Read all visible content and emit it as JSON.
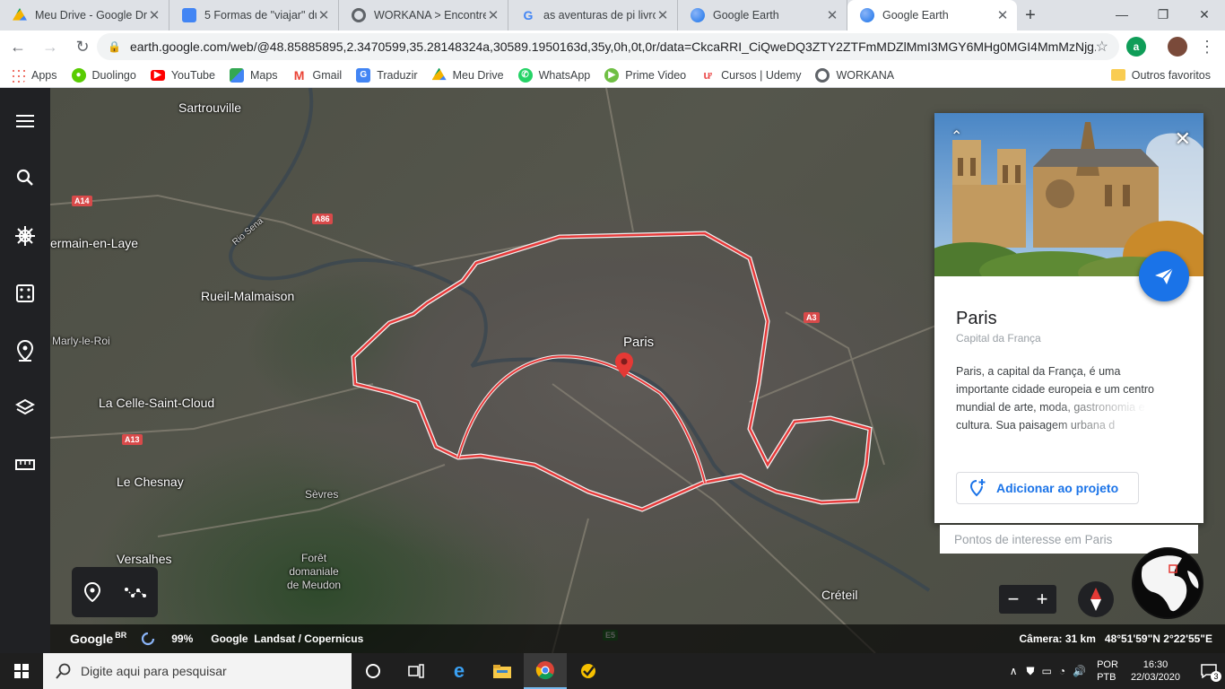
{
  "browser": {
    "tabs": [
      {
        "title": "Meu Drive - Google Dri",
        "favicon": "google-drive",
        "color": "#f4b400"
      },
      {
        "title": "5 Formas de \"viajar\" du",
        "favicon": "google-docs",
        "color": "#4285f4"
      },
      {
        "title": "WORKANA > Encontre",
        "favicon": "workana",
        "color": "#5f6368"
      },
      {
        "title": "as aventuras de pi livro",
        "favicon": "google-search",
        "color": "#4285f4"
      },
      {
        "title": "Google Earth",
        "favicon": "google-earth",
        "color": "#1a73e8"
      },
      {
        "title": "Google Earth",
        "favicon": "google-earth",
        "color": "#1a73e8",
        "active": true
      }
    ],
    "url": "earth.google.com/web/@48.85885895,2.3470599,35.28148324a,30589.1950163d,35y,0h,0t,0r/data=CkcaRRI_CiQweDQ3ZTY2ZTFmMDZlMmI3MGY6MHg0MGI4MmMzNjg...",
    "bookmarks": [
      {
        "label": "Apps",
        "icon": "apps-grid-icon"
      },
      {
        "label": "Duolingo",
        "icon": "duolingo-icon"
      },
      {
        "label": "YouTube",
        "icon": "youtube-icon"
      },
      {
        "label": "Maps",
        "icon": "maps-icon"
      },
      {
        "label": "Gmail",
        "icon": "gmail-icon"
      },
      {
        "label": "Traduzir",
        "icon": "translate-icon"
      },
      {
        "label": "Meu Drive",
        "icon": "drive-icon"
      },
      {
        "label": "WhatsApp",
        "icon": "whatsapp-icon"
      },
      {
        "label": "Prime Video",
        "icon": "prime-video-icon"
      },
      {
        "label": "Cursos | Udemy",
        "icon": "udemy-icon"
      },
      {
        "label": "WORKANA",
        "icon": "workana-icon"
      }
    ],
    "other_bookmarks": "Outros favoritos"
  },
  "map": {
    "labels": {
      "sartrouville": "Sartrouville",
      "germain": "ermain-en-Laye",
      "rueil": "Rueil-Malmaison",
      "marly": "Marly-le-Roi",
      "celle": "La Celle-Saint-Cloud",
      "chesnay": "Le Chesnay",
      "sevres": "Sèvres",
      "versalhes": "Versalhes",
      "foret": "Forêt\ndomaniale\nde Meudon",
      "paris": "Paris",
      "creteil": "Créteil",
      "riosena": "Rio Sena"
    },
    "shields": {
      "a14": "A14",
      "a86": "A86",
      "a13": "A13",
      "a3": "A3",
      "e5": "E5"
    }
  },
  "card": {
    "title": "Paris",
    "subtitle": "Capital da França",
    "description": "Paris, a capital da França, é uma importante cidade europeia e um centro mundial de arte, moda, gastronomia e cultura. Sua paisagem urbana d",
    "add_button": "Adicionar ao projeto",
    "poi_search": "Pontos de interesse em Paris"
  },
  "status": {
    "brand": "Google",
    "brand_suffix": "BR",
    "loading": "99%",
    "attribution": "Google  Landsat / Copernicus",
    "camera": "Câmera: 31 km",
    "coords": "48°51'59\"N 2°22'55\"E"
  },
  "taskbar": {
    "search_placeholder": "Digite aqui para pesquisar",
    "lang": "POR",
    "layout": "PTB",
    "time": "16:30",
    "date": "22/03/2020",
    "notifications": "3"
  }
}
